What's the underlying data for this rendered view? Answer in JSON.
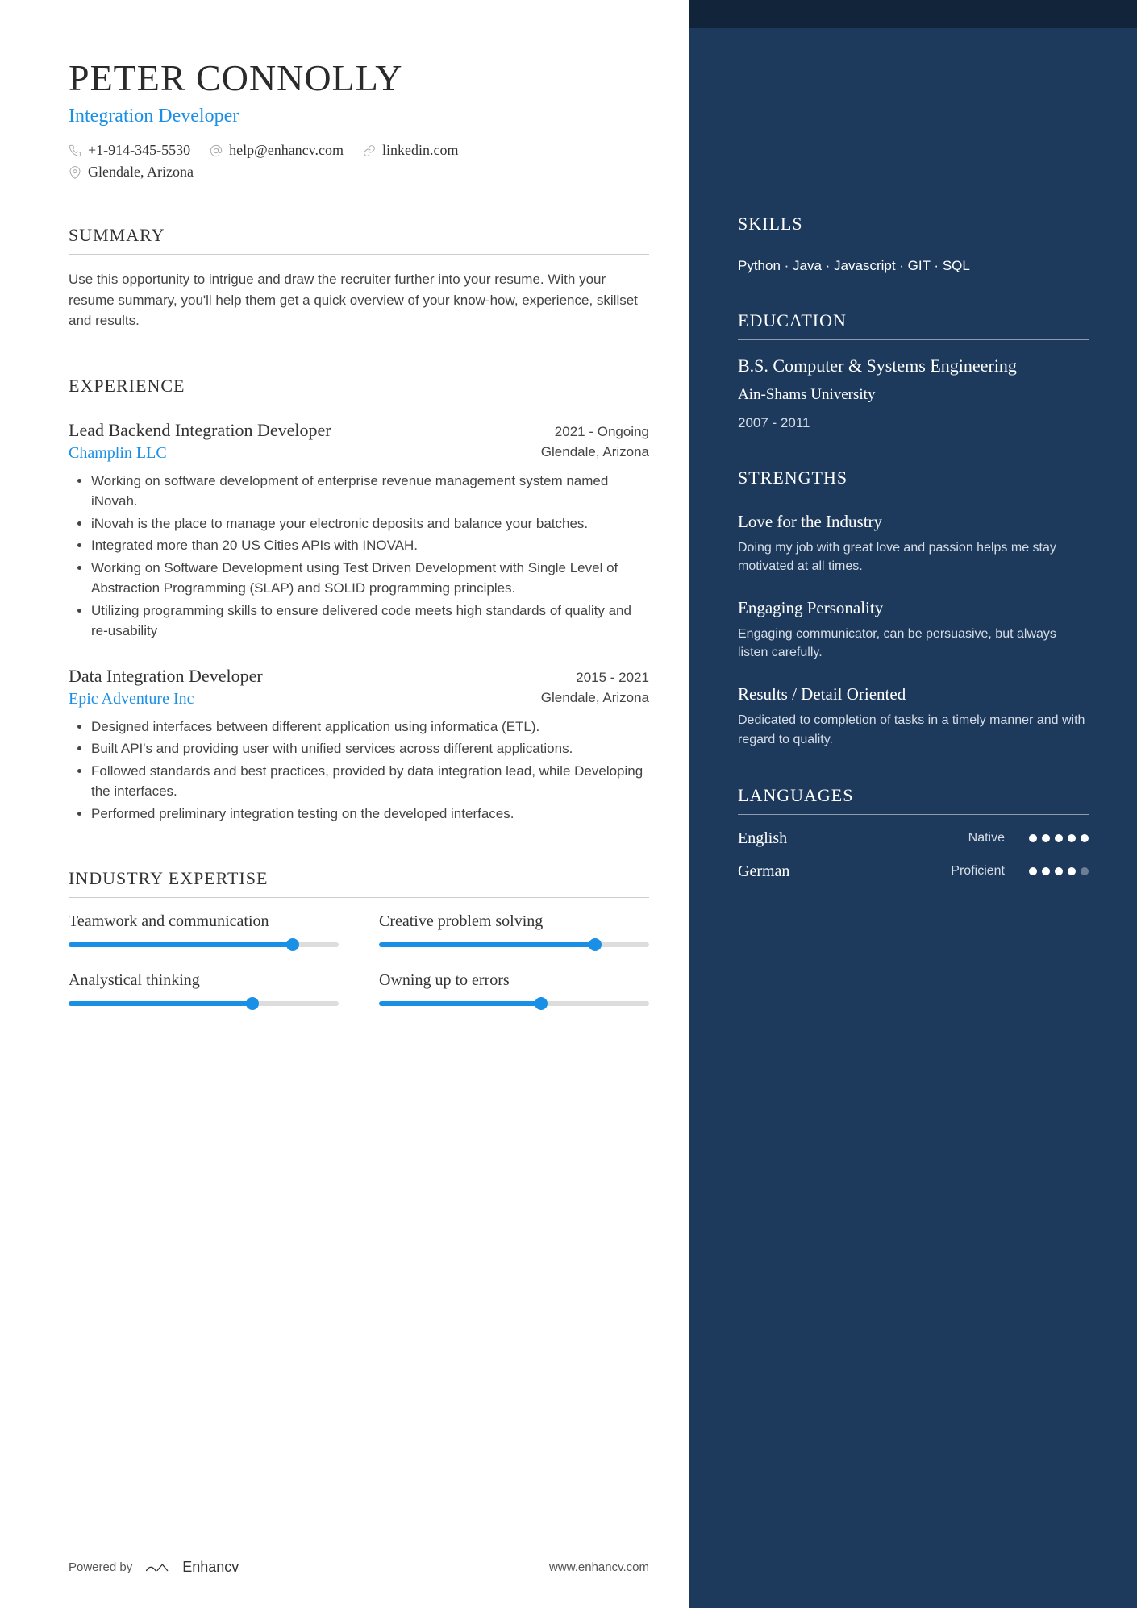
{
  "header": {
    "name": "PETER CONNOLLY",
    "title": "Integration Developer",
    "phone": "+1-914-345-5530",
    "email": "help@enhancv.com",
    "linkedin": "linkedin.com",
    "location": "Glendale, Arizona"
  },
  "summary": {
    "heading": "SUMMARY",
    "text": "Use this opportunity to intrigue and draw the recruiter further into your resume. With your resume summary, you'll help them get a quick overview of your know-how, experience, skillset and results."
  },
  "experience": {
    "heading": "EXPERIENCE",
    "jobs": [
      {
        "title": "Lead Backend Integration Developer",
        "dates": "2021 - Ongoing",
        "company": "Champlin LLC",
        "location": "Glendale, Arizona",
        "bullets": [
          "Working on software development of enterprise revenue management system named iNovah.",
          "iNovah is the place to manage your electronic deposits and balance your batches.",
          "Integrated more than 20 US Cities APIs with INOVAH.",
          "Working on Software Development using Test Driven Development with Single Level of Abstraction Programming (SLAP) and SOLID programming principles.",
          "Utilizing programming skills to ensure delivered code meets high standards of quality and re-usability"
        ]
      },
      {
        "title": "Data Integration Developer",
        "dates": "2015 - 2021",
        "company": "Epic Adventure Inc",
        "location": "Glendale, Arizona",
        "bullets": [
          "Designed interfaces between different application using informatica (ETL).",
          "Built API's and providing user with unified services across different applications.",
          "Followed standards and best practices, provided by data integration lead, while Developing the interfaces.",
          "Performed preliminary integration testing on the developed interfaces."
        ]
      }
    ]
  },
  "expertise": {
    "heading": "INDUSTRY EXPERTISE",
    "items": [
      {
        "label": "Teamwork and communication",
        "pct": 83
      },
      {
        "label": "Creative problem solving",
        "pct": 80
      },
      {
        "label": "Analystical thinking",
        "pct": 68
      },
      {
        "label": "Owning up to errors",
        "pct": 60
      }
    ]
  },
  "sidebar": {
    "skills": {
      "heading": "SKILLS",
      "text": "Python · Java · Javascript · GIT · SQL"
    },
    "education": {
      "heading": "EDUCATION",
      "degree": "B.S. Computer & Systems Engineering",
      "school": "Ain-Shams University",
      "dates": "2007 - 2011"
    },
    "strengths": {
      "heading": "STRENGTHS",
      "items": [
        {
          "title": "Love for the Industry",
          "desc": "Doing my job with great love and passion helps me stay motivated at all times."
        },
        {
          "title": "Engaging Personality",
          "desc": "Engaging communicator, can be persuasive, but always listen carefully."
        },
        {
          "title": "Results / Detail Oriented",
          "desc": "Dedicated to completion of tasks in a timely manner and with regard to quality."
        }
      ]
    },
    "languages": {
      "heading": "LANGUAGES",
      "items": [
        {
          "name": "English",
          "level": "Native",
          "dots": 5
        },
        {
          "name": "German",
          "level": "Proficient",
          "dots": 4
        }
      ]
    }
  },
  "footer": {
    "powered": "Powered by",
    "brand": "Enhancv",
    "url": "www.enhancv.com"
  }
}
